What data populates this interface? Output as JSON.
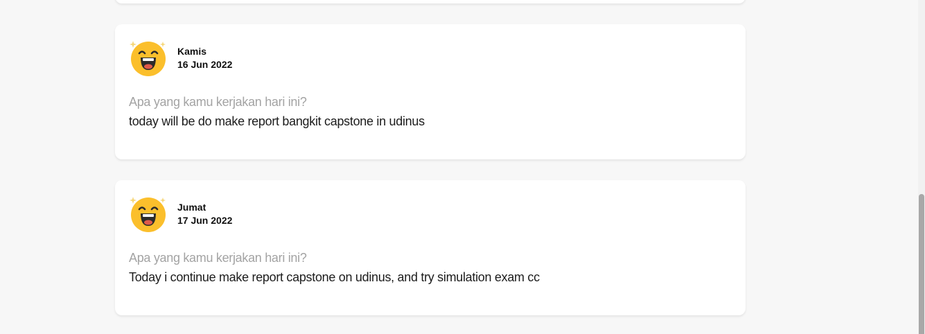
{
  "entries": [
    {
      "day": "Kamis",
      "date": "16 Jun 2022",
      "question": "Apa yang kamu kerjakan hari ini?",
      "answer": "today will be do make report bangkit capstone in udinus",
      "mood_icon": "laughing-emoji-icon"
    },
    {
      "day": "Jumat",
      "date": "17 Jun 2022",
      "question": "Apa yang kamu kerjakan hari ini?",
      "answer": "Today i continue make report capstone on udinus, and try simulation exam cc",
      "mood_icon": "laughing-emoji-icon"
    }
  ],
  "colors": {
    "background": "#f7f7f7",
    "card": "#ffffff",
    "emoji_face": "#fbbf2c",
    "question_text": "#a3a3a3",
    "answer_text": "#1c1c1c"
  }
}
